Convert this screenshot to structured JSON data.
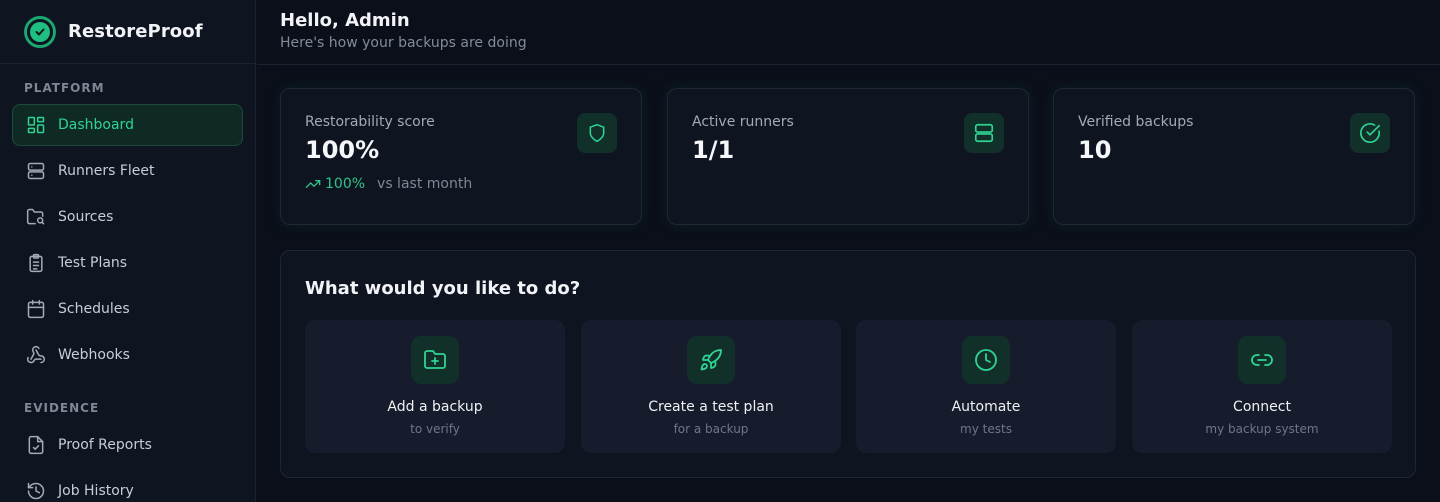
{
  "brand": {
    "name": "RestoreProof"
  },
  "sidebar": {
    "sections": [
      {
        "label": "PLATFORM"
      },
      {
        "label": "EVIDENCE"
      }
    ],
    "items": [
      {
        "label": "Dashboard",
        "icon": "layout-grid-icon",
        "active": true
      },
      {
        "label": "Runners Fleet",
        "icon": "server-icon"
      },
      {
        "label": "Sources",
        "icon": "folder-search-icon"
      },
      {
        "label": "Test Plans",
        "icon": "clipboard-list-icon"
      },
      {
        "label": "Schedules",
        "icon": "calendar-icon"
      },
      {
        "label": "Webhooks",
        "icon": "webhook-icon"
      },
      {
        "label": "Proof Reports",
        "icon": "file-check-icon"
      },
      {
        "label": "Job History",
        "icon": "history-icon"
      }
    ]
  },
  "header": {
    "title": "Hello, Admin",
    "subtitle": "Here's how your backups are doing"
  },
  "stats": [
    {
      "label": "Restorability score",
      "value": "100%",
      "trend_value": "100%",
      "trend_text": "vs last month",
      "icon": "shield-icon"
    },
    {
      "label": "Active runners",
      "value": "1/1",
      "icon": "server-icon"
    },
    {
      "label": "Verified backups",
      "value": "10",
      "icon": "circle-check-icon"
    }
  ],
  "actions": {
    "title": "What would you like to do?",
    "items": [
      {
        "title": "Add a backup",
        "subtitle": "to verify",
        "icon": "folder-plus-icon"
      },
      {
        "title": "Create a test plan",
        "subtitle": "for a backup",
        "icon": "rocket-icon"
      },
      {
        "title": "Automate",
        "subtitle": "my tests",
        "icon": "clock-icon"
      },
      {
        "title": "Connect",
        "subtitle": "my backup system",
        "icon": "link-icon"
      }
    ]
  },
  "colors": {
    "accent": "#1fbf83",
    "active_text": "#2fd492",
    "background": "#0b0f19",
    "panel": "#0f1421"
  }
}
